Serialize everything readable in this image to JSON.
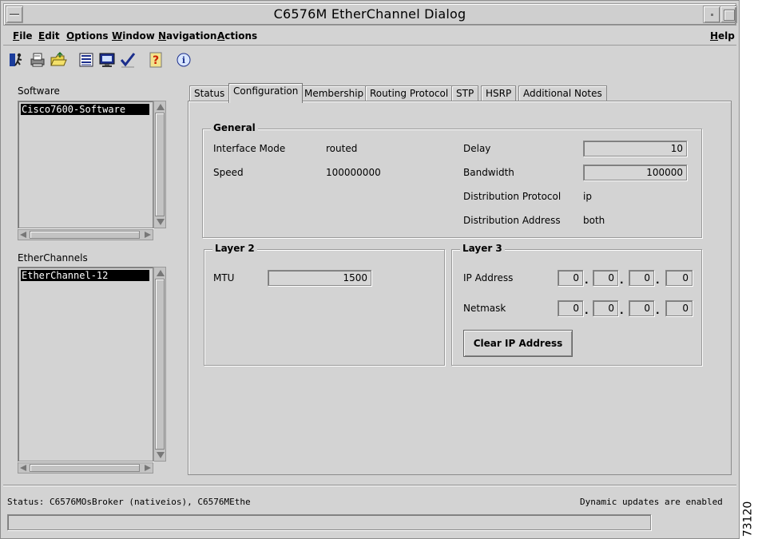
{
  "window": {
    "title": "C6576M EtherChannel Dialog"
  },
  "menubar": {
    "file": "File",
    "edit": "Edit",
    "options": "Options",
    "window": "Window",
    "navigation": "Navigation",
    "actions": "Actions",
    "help": "Help"
  },
  "toolbar": {
    "icons": [
      "exit-icon",
      "print-icon",
      "open-folder-icon",
      "list-icon",
      "monitor-icon",
      "checkmark-icon",
      "help-icon",
      "info-icon"
    ]
  },
  "software": {
    "label": "Software",
    "items": [
      "Cisco7600-Software"
    ]
  },
  "etherchannels": {
    "label": "EtherChannels",
    "items": [
      "EtherChannel-12"
    ]
  },
  "tabs": [
    "Status",
    "Configuration",
    "Membership",
    "Routing Protocol",
    "STP",
    "HSRP",
    "Additional Notes"
  ],
  "active_tab": "Configuration",
  "general": {
    "title": "General",
    "interface_mode_label": "Interface Mode",
    "interface_mode_value": "routed",
    "speed_label": "Speed",
    "speed_value": "100000000",
    "delay_label": "Delay",
    "delay_value": "10",
    "bandwidth_label": "Bandwidth",
    "bandwidth_value": "100000",
    "distribution_protocol_label": "Distribution Protocol",
    "distribution_protocol_value": "ip",
    "distribution_address_label": "Distribution Address",
    "distribution_address_value": "both"
  },
  "layer2": {
    "title": "Layer 2",
    "mtu_label": "MTU",
    "mtu_value": "1500"
  },
  "layer3": {
    "title": "Layer 3",
    "ip_label": "IP Address",
    "ip_octets": [
      "0",
      "0",
      "0",
      "0"
    ],
    "netmask_label": "Netmask",
    "netmask_octets": [
      "0",
      "0",
      "0",
      "0"
    ],
    "clear_button": "Clear IP Address"
  },
  "status": {
    "left": "Status: C6576MOsBroker (nativeios), C6576MEthe",
    "right": "Dynamic updates are enabled"
  },
  "figure_id": "73120",
  "colors": {
    "background": "#d3d3d3",
    "selection": "#000000"
  }
}
